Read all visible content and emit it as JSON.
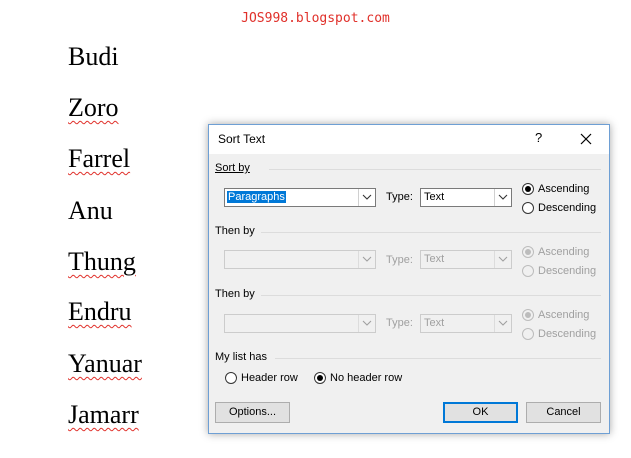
{
  "watermark": "JOS998.blogspot.com",
  "document": {
    "names": [
      "Budi",
      "Zoro",
      "Farrel",
      "Anu",
      "Thung",
      "Endru",
      "Yanuar",
      "Jamarr"
    ]
  },
  "dialog": {
    "title": "Sort Text",
    "help_label": "?",
    "sort_by": {
      "label": "Sort by",
      "field_value": "Paragraphs",
      "type_label": "Type:",
      "type_value": "Text",
      "ascending": "Ascending",
      "descending": "Descending",
      "selected": "ascending"
    },
    "then_by_1": {
      "label": "Then by",
      "field_value": "",
      "type_label": "Type:",
      "type_value": "Text",
      "ascending": "Ascending",
      "descending": "Descending",
      "selected": "ascending",
      "disabled": true
    },
    "then_by_2": {
      "label": "Then by",
      "field_value": "",
      "type_label": "Type:",
      "type_value": "Text",
      "ascending": "Ascending",
      "descending": "Descending",
      "selected": "ascending",
      "disabled": true
    },
    "my_list_has": {
      "label": "My list has",
      "header_row": "Header row",
      "no_header_row": "No header row",
      "selected": "no_header_row"
    },
    "buttons": {
      "options": "Options...",
      "ok": "OK",
      "cancel": "Cancel"
    }
  },
  "colors": {
    "watermark": "#e0302a",
    "selection": "#0078d7",
    "dialog_border": "#6e9fd4"
  }
}
